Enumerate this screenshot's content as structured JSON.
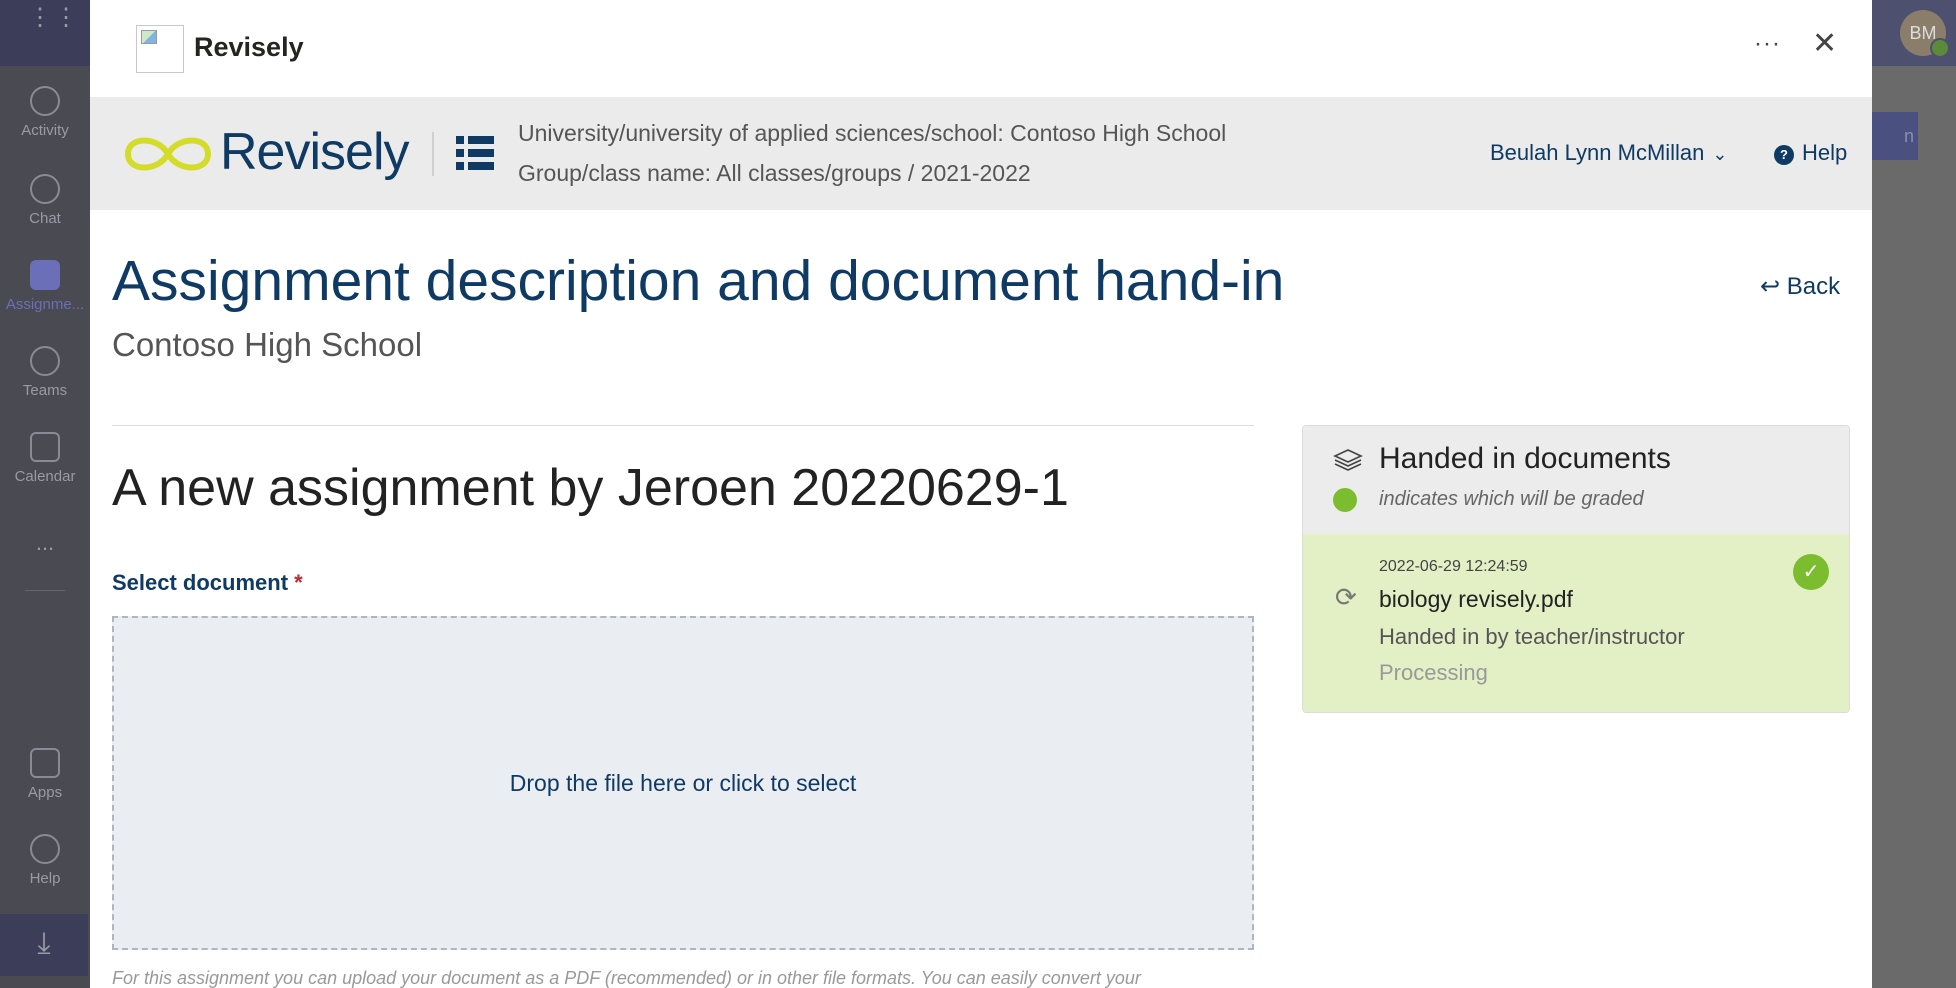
{
  "teams_rail": {
    "items": [
      {
        "label": "Activity",
        "icon": "bell-icon"
      },
      {
        "label": "Chat",
        "icon": "chat-icon"
      },
      {
        "label": "Assignme...",
        "icon": "backpack-icon",
        "active": true
      },
      {
        "label": "Teams",
        "icon": "teams-icon"
      },
      {
        "label": "Calendar",
        "icon": "calendar-icon"
      },
      {
        "label": "...",
        "icon": "more-icon"
      },
      {
        "label": "Apps",
        "icon": "apps-icon"
      },
      {
        "label": "Help",
        "icon": "help-icon"
      }
    ],
    "avatar_initials": "BM"
  },
  "modal": {
    "app_title": "Revisely",
    "more_label": "···",
    "close_label": "✕"
  },
  "revisely_header": {
    "logo_word": "Revisely",
    "context_line1": "University/university of applied sciences/school: Contoso High School",
    "context_line2": "Group/class name: All classes/groups / 2021-2022",
    "user_name": "Beulah Lynn McMillan",
    "help_label": "Help"
  },
  "page": {
    "title": "Assignment description and document hand-in",
    "back_label": "Back",
    "school": "Contoso High School",
    "assignment_title": "A new assignment by Jeroen 20220629-1",
    "select_label": "Select document",
    "required_mark": "*",
    "dropzone_text": "Drop the file here or click to select",
    "footnote": "For this assignment you can upload your document as a PDF (recommended) or in other file formats. You can easily convert your"
  },
  "handed_in": {
    "title": "Handed in documents",
    "legend": "indicates which will be graded",
    "items": [
      {
        "timestamp": "2022-06-29 12:24:59",
        "filename": "biology revisely.pdf",
        "handed_by": "Handed in by teacher/instructor",
        "status": "Processing"
      }
    ]
  },
  "colors": {
    "brand_navy": "#0f3a63",
    "logo_yellow": "#d4dc2a",
    "graded_green": "#7cbd2f",
    "item_bg": "#e3efc4"
  }
}
